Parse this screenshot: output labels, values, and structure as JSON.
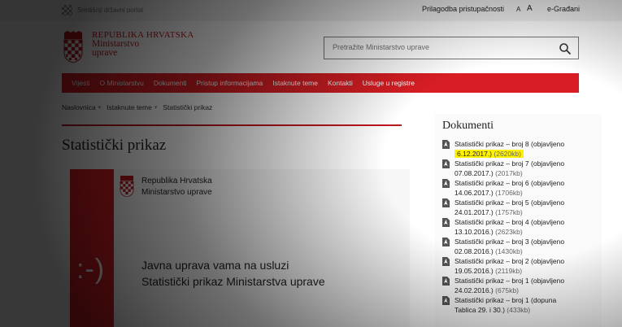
{
  "topbar": {
    "portal_label": "Središnji državni portal",
    "accessibility": "Prilagodba pristupačnosti",
    "font_small": "A",
    "font_large": "A",
    "e_citizens": "e-Građani"
  },
  "header": {
    "logo_line1": "REPUBLIKA HRVATSKA",
    "logo_line2": "Ministarstvo",
    "logo_line3": "uprave",
    "search_placeholder": "Pretražite Ministarstvo uprave"
  },
  "nav": {
    "items": [
      "Vijesti",
      "O Ministarstvu",
      "Dokumenti",
      "Pristup informacijama",
      "Istaknute teme",
      "Kontakti",
      "Usluge u registre"
    ]
  },
  "breadcrumb": {
    "items": [
      "Naslovnica",
      "Istaknute teme",
      "Statistički prikaz"
    ]
  },
  "main": {
    "title": "Statistički prikaz",
    "banner": {
      "org_line1": "Republika Hrvatska",
      "org_line2": "Ministarstvo uprave",
      "smiley": ":-)",
      "tagline_line1": "Javna uprava vama na usluzi",
      "tagline_line2": "Statistički prikaz Ministarstva uprave"
    }
  },
  "docs": {
    "heading": "Dokumenti",
    "items": [
      {
        "line1": "Statistički prikaz – broj 8 (objavljeno",
        "line2": "6.12.2017.)",
        "size": "(2620kb)",
        "highlighted": true
      },
      {
        "line1": "Statistički prikaz – broj 7 (objavljeno",
        "line2": "07.08.2017.)",
        "size": "(2017kb)"
      },
      {
        "line1": "Statistički prikaz – broj 6 (objavljeno",
        "line2": "14.06.2017.)",
        "size": "(1706kb)"
      },
      {
        "line1": "Statistički prikaz – broj 5 (objavljeno",
        "line2": "24.01.2017.)",
        "size": "(1757kb)"
      },
      {
        "line1": "Statistički prikaz – broj 4 (objavljeno",
        "line2": "13.10.2016.)",
        "size": "(2623kb)"
      },
      {
        "line1": "Statistički prikaz – broj 3 (objavljeno",
        "line2": "02.08.2016.)",
        "size": "(1430kb)"
      },
      {
        "line1": "Statistički prikaz – broj 2 (objavljeno",
        "line2": "19.05.2016.)",
        "size": "(2119kb)"
      },
      {
        "line1": "Statistički prikaz – broj 1 (objavljeno",
        "line2": "24.02.2016.)",
        "size": "(675kb)"
      },
      {
        "line1": "Statistički prikaz – broj 1 (dopuna",
        "line2": "Tablica 29. i 30.)",
        "size": "(433kb)"
      }
    ]
  },
  "colors": {
    "brand_red": "#d81e24",
    "highlight": "#fff200"
  }
}
